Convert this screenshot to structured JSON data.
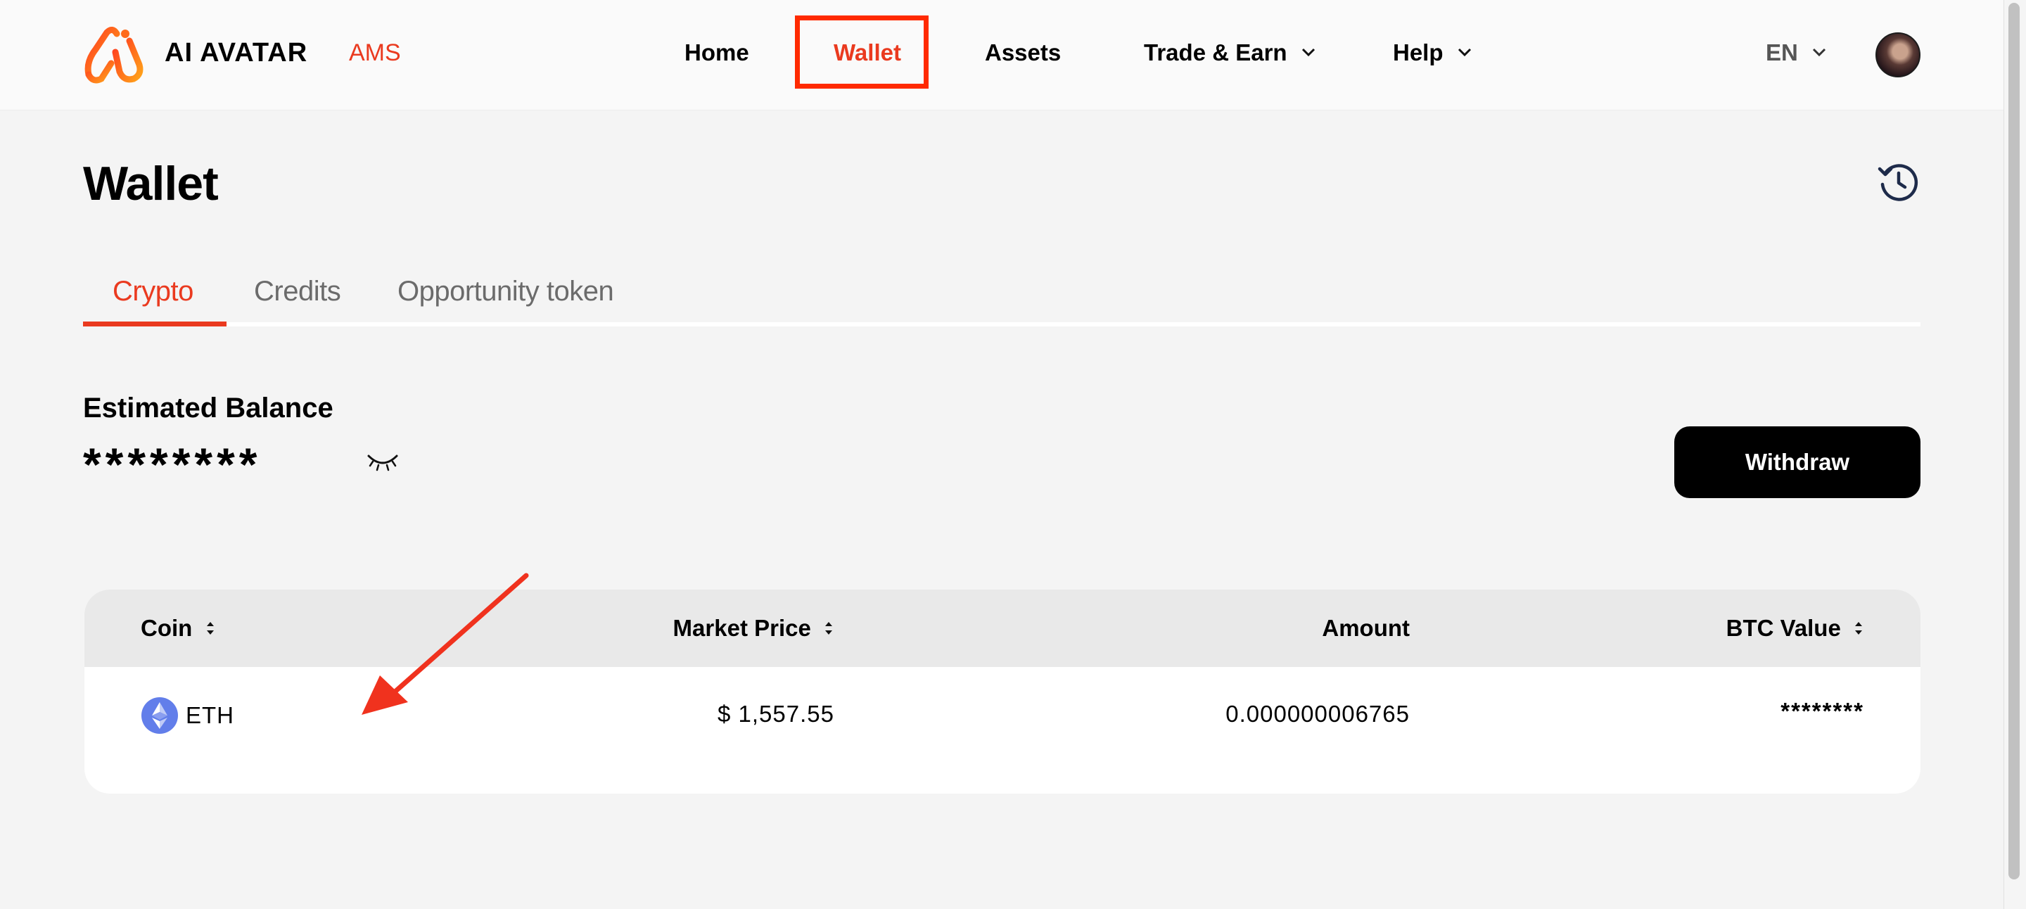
{
  "header": {
    "brand_name": "AI AVATAR",
    "brand_suffix": "AMS",
    "nav": {
      "home": "Home",
      "wallet": "Wallet",
      "assets": "Assets",
      "trade": "Trade & Earn",
      "help": "Help"
    },
    "language": "EN"
  },
  "page": {
    "title": "Wallet",
    "tabs": {
      "crypto": "Crypto",
      "credits": "Credits",
      "opportunity": "Opportunity token"
    },
    "active_tab": "Crypto",
    "balance_label": "Estimated Balance",
    "balance_value": "********",
    "withdraw_label": "Withdraw"
  },
  "table": {
    "headers": {
      "coin": "Coin",
      "price": "Market Price",
      "amount": "Amount",
      "btc": "BTC Value"
    },
    "rows": [
      {
        "coin": "ETH",
        "price": "$ 1,557.55",
        "amount": "0.000000006765",
        "btc": "********"
      }
    ]
  },
  "colors": {
    "accent": "#ea3a1f",
    "highlight_box": "#ff2a00",
    "annotation_arrow": "#f0321e"
  },
  "icons": [
    "logo-icon",
    "chevron-down-icon",
    "avatar",
    "history-icon",
    "eye-closed-icon",
    "sort-icon",
    "eth-icon",
    "annotation-arrow"
  ]
}
